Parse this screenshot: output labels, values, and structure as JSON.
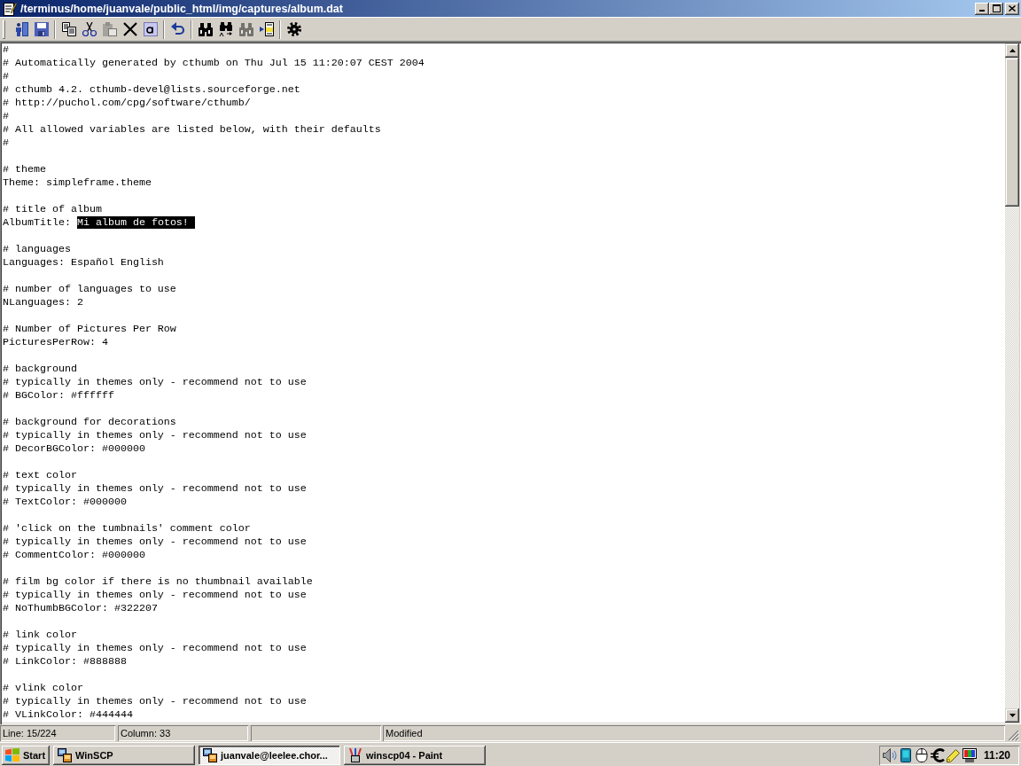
{
  "window": {
    "title": "/terminus/home/juanvale/public_html/img/captures/album.dat"
  },
  "toolbar": [
    [
      {
        "kind": "exit",
        "disabled": false
      },
      {
        "kind": "save",
        "disabled": false
      }
    ],
    [
      {
        "kind": "copy",
        "disabled": false
      },
      {
        "kind": "cut",
        "disabled": false
      },
      {
        "kind": "paste",
        "disabled": true
      },
      {
        "kind": "delete",
        "disabled": false
      },
      {
        "kind": "select-all",
        "disabled": false
      }
    ],
    [
      {
        "kind": "undo",
        "disabled": false
      }
    ],
    [
      {
        "kind": "find",
        "disabled": false
      },
      {
        "kind": "replace",
        "disabled": false
      },
      {
        "kind": "find-next",
        "disabled": true
      },
      {
        "kind": "go-to-line",
        "disabled": false
      }
    ],
    [
      {
        "kind": "settings",
        "disabled": false
      }
    ]
  ],
  "editor": {
    "blocks": [
      [
        {
          "text": "#"
        },
        {
          "text": "# Automatically generated by cthumb on Thu Jul 15 11:20:07 CEST 2004"
        },
        {
          "text": "#"
        },
        {
          "text": "# cthumb 4.2. cthumb-devel@lists.sourceforge.net"
        },
        {
          "text": "# http://puchol.com/cpg/software/cthumb/"
        },
        {
          "text": "#"
        },
        {
          "text": "# All allowed variables are listed below, with their defaults"
        },
        {
          "text": "#"
        }
      ],
      [
        {
          "text": "# theme"
        },
        {
          "text": "Theme: simpleframe.theme"
        }
      ],
      [
        {
          "text": "# title of album"
        },
        {
          "text": "AlbumTitle: ",
          "selection": "Mi album de fotos! "
        }
      ],
      [
        {
          "text": "# languages"
        },
        {
          "text": "Languages: Español English"
        }
      ],
      [
        {
          "text": "# number of languages to use"
        },
        {
          "text": "NLanguages: 2"
        }
      ],
      [
        {
          "text": "# Number of Pictures Per Row"
        },
        {
          "text": "PicturesPerRow: 4"
        }
      ],
      [
        {
          "text": "# background"
        },
        {
          "text": "# typically in themes only - recommend not to use"
        },
        {
          "text": "# BGColor: #ffffff"
        }
      ],
      [
        {
          "text": "# background for decorations"
        },
        {
          "text": "# typically in themes only - recommend not to use"
        },
        {
          "text": "# DecorBGColor: #000000"
        }
      ],
      [
        {
          "text": "# text color"
        },
        {
          "text": "# typically in themes only - recommend not to use"
        },
        {
          "text": "# TextColor: #000000"
        }
      ],
      [
        {
          "text": "# 'click on the tumbnails' comment color"
        },
        {
          "text": "# typically in themes only - recommend not to use"
        },
        {
          "text": "# CommentColor: #000000"
        }
      ],
      [
        {
          "text": "# film bg color if there is no thumbnail available"
        },
        {
          "text": "# typically in themes only - recommend not to use"
        },
        {
          "text": "# NoThumbBGColor: #322207"
        }
      ],
      [
        {
          "text": "# link color"
        },
        {
          "text": "# typically in themes only - recommend not to use"
        },
        {
          "text": "# LinkColor: #888888"
        }
      ],
      [
        {
          "text": "# vlink color"
        },
        {
          "text": "# typically in themes only - recommend not to use"
        },
        {
          "text": "# VLinkColor: #444444"
        }
      ]
    ]
  },
  "status_bar": {
    "line": "Line: 15/224",
    "column": "Column: 33",
    "modified": "Modified"
  },
  "taskbar": {
    "start": "Start",
    "tasks": [
      {
        "label": "WinSCP",
        "kind": "winscp",
        "selected": false
      },
      {
        "label": "juanvale@leelee.chor...",
        "kind": "winscp",
        "selected": true
      },
      {
        "label": "winscp04 - Paint",
        "kind": "paint",
        "selected": false
      }
    ],
    "time": "11:20"
  }
}
